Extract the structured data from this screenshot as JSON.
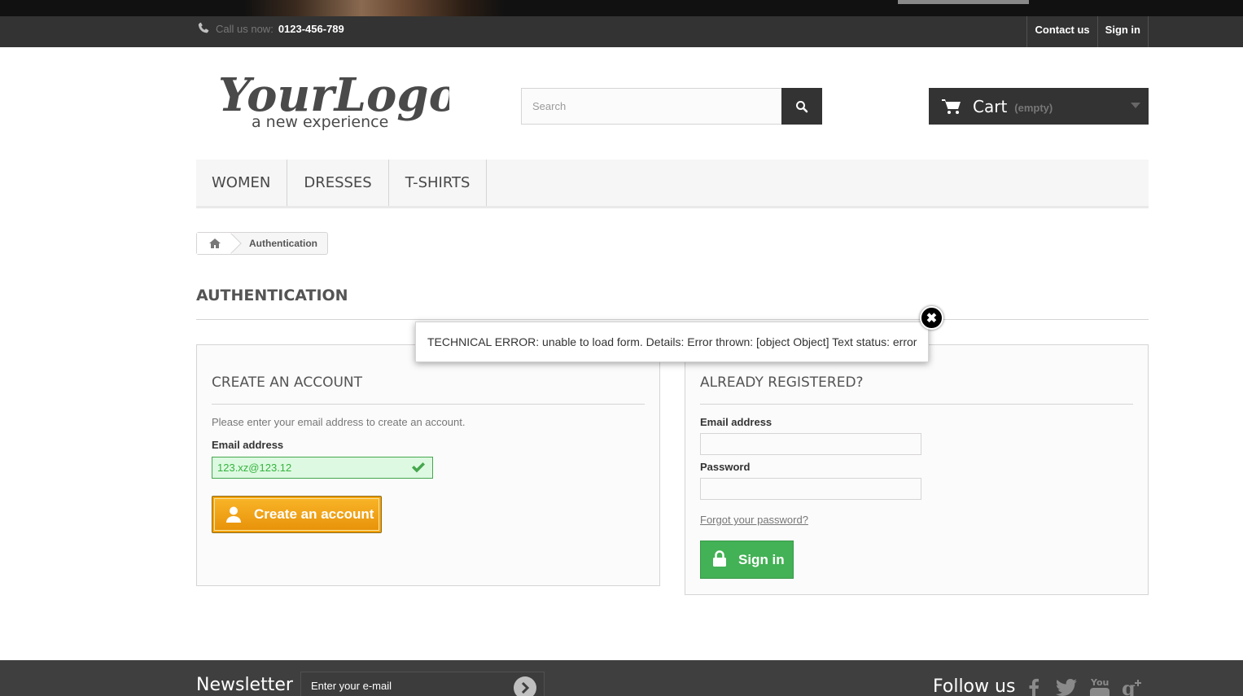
{
  "nav": {
    "phone_label": "Call us now:",
    "phone_number": "0123-456-789",
    "links": [
      "Contact us",
      "Sign in"
    ]
  },
  "header": {
    "logo_main": "YourLogo",
    "logo_tagline": "a new experience",
    "search_placeholder": "Search",
    "cart_label": "Cart",
    "cart_status": "(empty)"
  },
  "menu": [
    "WOMEN",
    "DRESSES",
    "T-SHIRTS"
  ],
  "breadcrumb": {
    "current": "Authentication"
  },
  "page_title": "AUTHENTICATION",
  "create_account": {
    "title": "CREATE AN ACCOUNT",
    "description": "Please enter your email address to create an account.",
    "email_label": "Email address",
    "email_value": "123.xz@123.12",
    "button_label": "Create an account"
  },
  "login": {
    "title": "ALREADY REGISTERED?",
    "email_label": "Email address",
    "password_label": "Password",
    "forgot_label": "Forgot your password?",
    "button_label": "Sign in"
  },
  "error_dialog": {
    "message": "TECHNICAL ERROR: unable to load form. Details: Error thrown: [object Object] Text status: error",
    "close_label": "✖"
  },
  "footer": {
    "newsletter_title": "Newsletter",
    "newsletter_placeholder": "Enter your e-mail",
    "follow_title": "Follow us",
    "social": [
      "facebook-icon",
      "twitter-icon",
      "youtube-icon",
      "google-plus-icon"
    ]
  },
  "colors": {
    "create_button": "#f4a20a",
    "signin_button": "#43b155",
    "valid_field": "#ddf9e1"
  }
}
